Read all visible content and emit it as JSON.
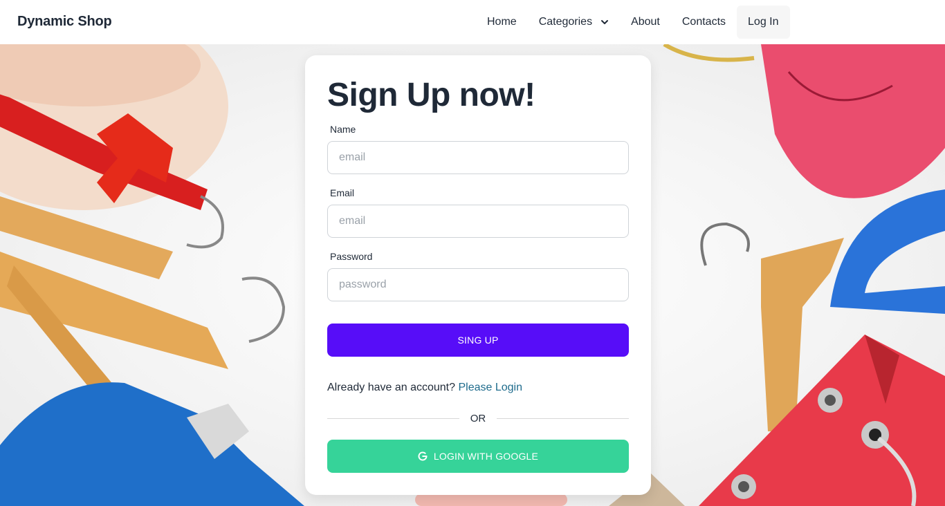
{
  "navbar": {
    "brand": "Dynamic Shop",
    "items": [
      {
        "label": "Home"
      },
      {
        "label": "Categories",
        "has_dropdown": true
      },
      {
        "label": "About"
      },
      {
        "label": "Contacts"
      },
      {
        "label": "Log In"
      }
    ]
  },
  "signup": {
    "title": "Sign Up now!",
    "fields": [
      {
        "label": "Name",
        "placeholder": "email",
        "value": ""
      },
      {
        "label": "Email",
        "placeholder": "email",
        "value": ""
      },
      {
        "label": "Password",
        "placeholder": "password",
        "value": ""
      }
    ],
    "submit_label": "SING UP",
    "already_text": "Already have an account?",
    "login_link": "Please Login",
    "divider_text": "OR",
    "google_label": "LOGIN WITH GOOGLE"
  },
  "colors": {
    "primary": "#570df8",
    "success": "#36d399",
    "link": "#1e6b8c",
    "text": "#1f2937"
  },
  "icons": [
    "chevron-down-icon",
    "google-icon"
  ]
}
